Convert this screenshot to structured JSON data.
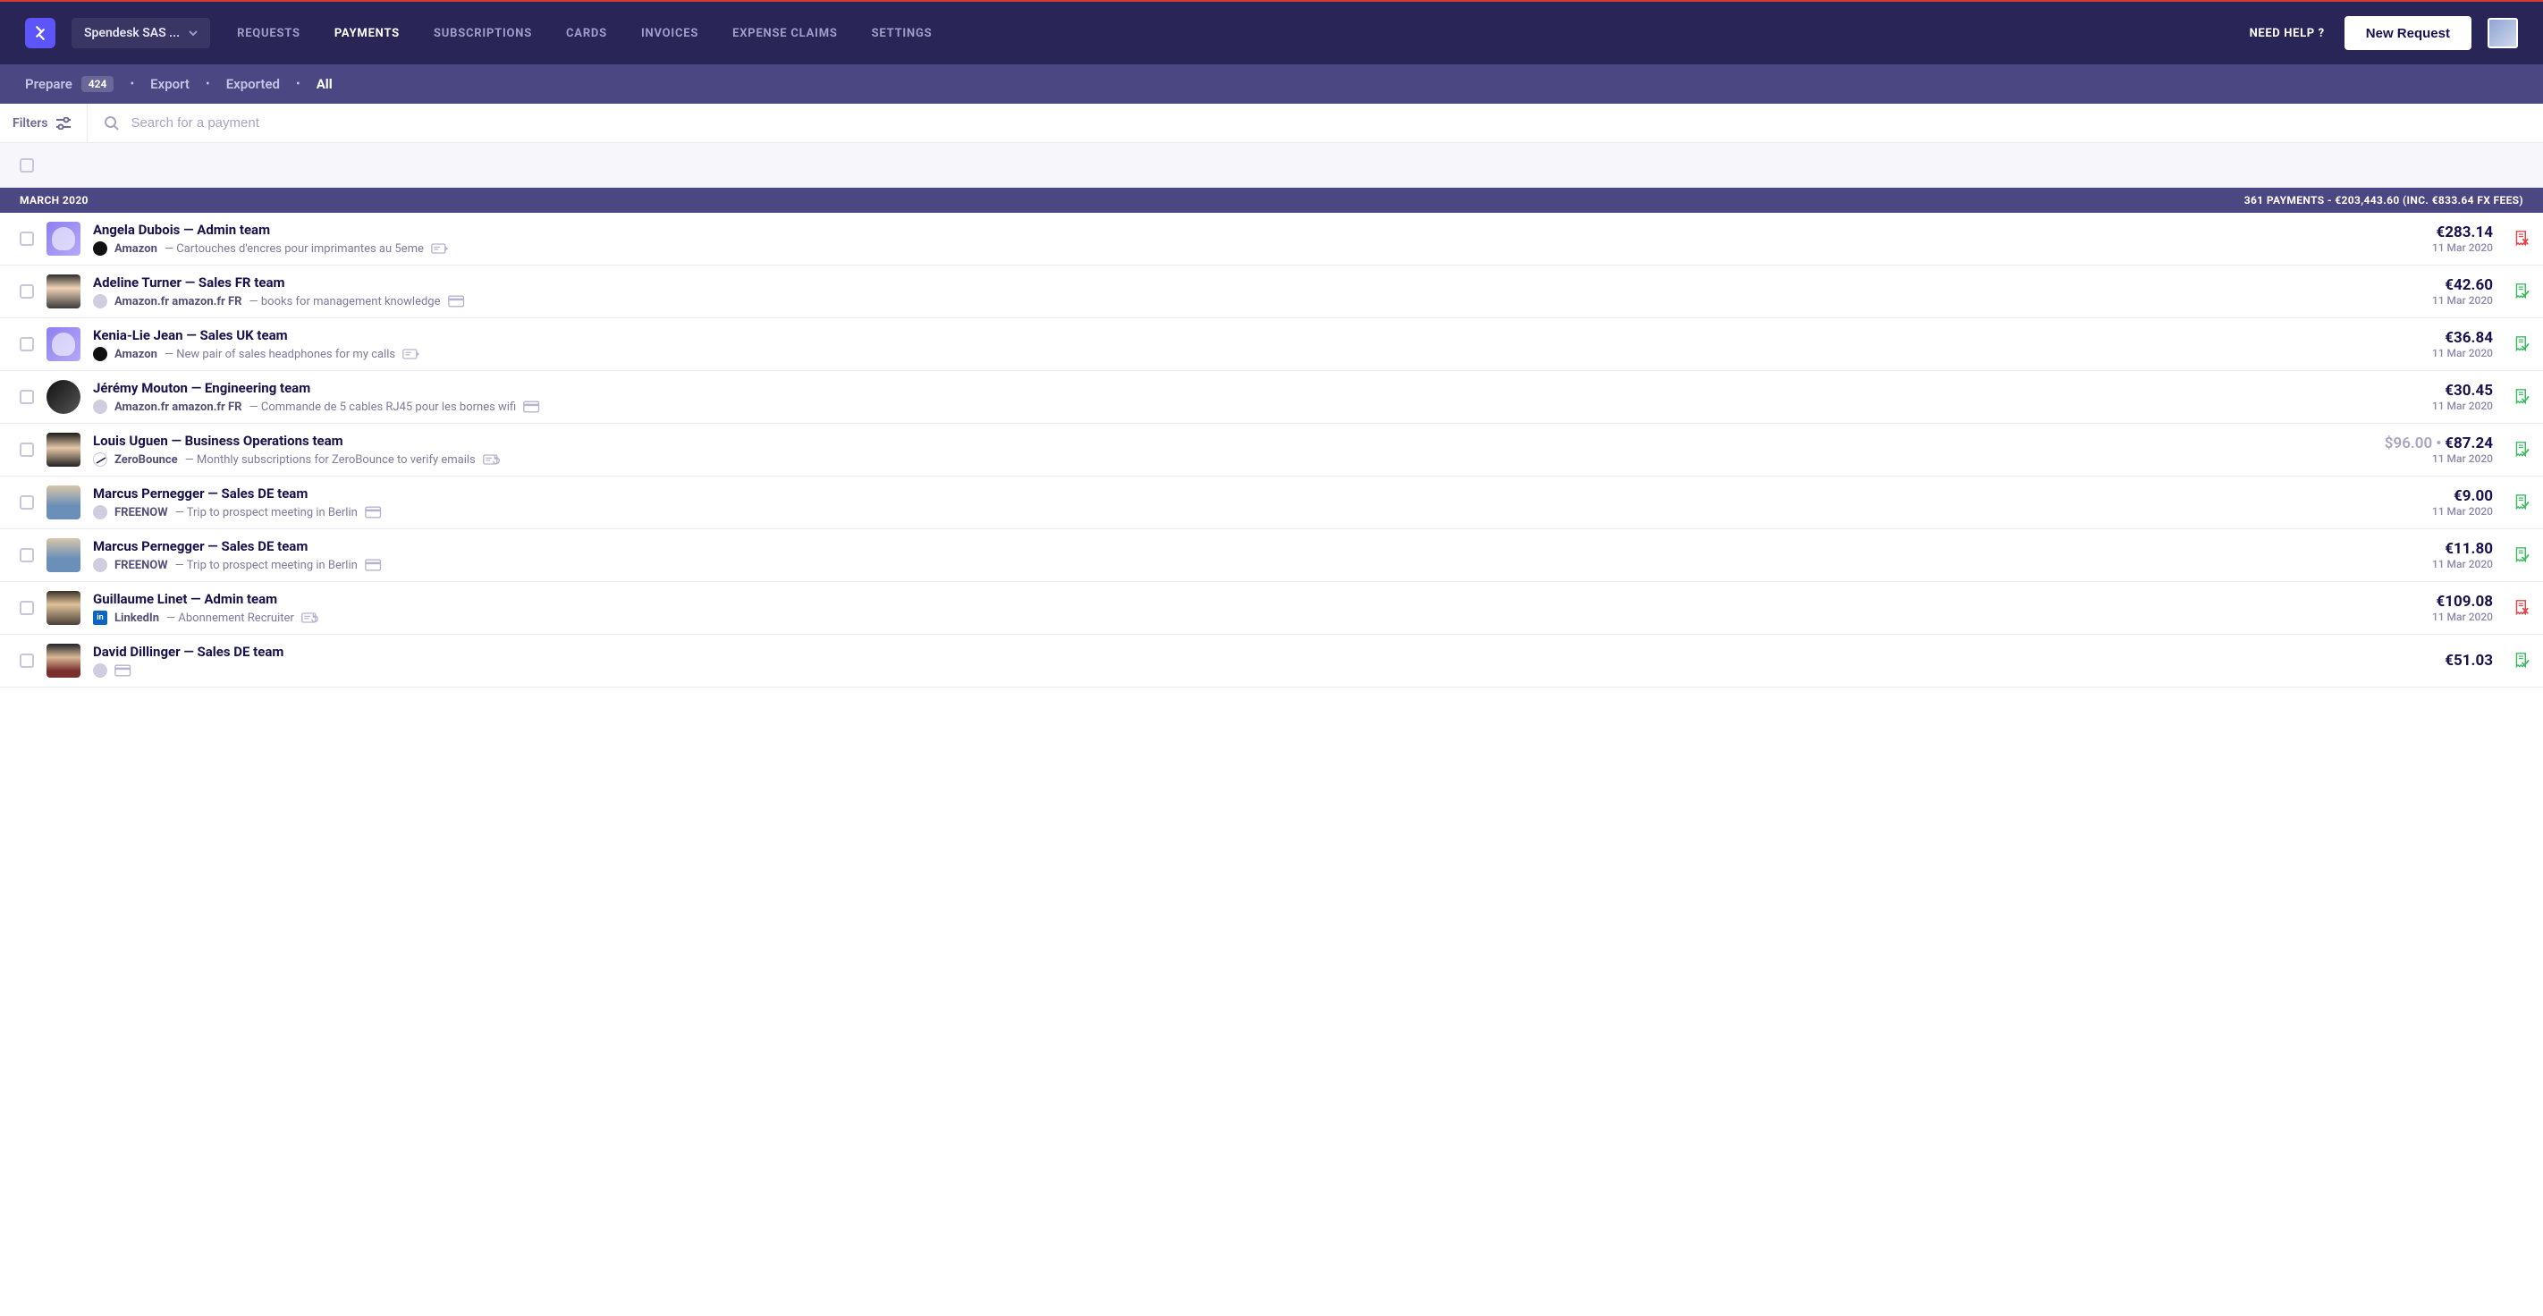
{
  "topbar": {
    "account_name": "Spendesk SAS ...",
    "nav": {
      "requests": "REQUESTS",
      "payments": "PAYMENTS",
      "subscriptions": "SUBSCRIPTIONS",
      "cards": "CARDS",
      "invoices": "INVOICES",
      "expense_claims": "EXPENSE CLAIMS",
      "settings": "SETTINGS"
    },
    "need_help": "NEED HELP ?",
    "new_request": "New Request"
  },
  "subnav": {
    "prepare": "Prepare",
    "prepare_count": "424",
    "export": "Export",
    "exported": "Exported",
    "all": "All"
  },
  "filter_bar": {
    "filters": "Filters",
    "search_placeholder": "Search for a payment"
  },
  "month_bar": {
    "label": "MARCH 2020",
    "summary": "361 PAYMENTS - €203,443.60 (INC. €833.64 FX FEES)"
  },
  "rows": [
    {
      "title": "Angela Dubois — Admin team",
      "merchant": "Amazon",
      "desc": "— Cartouches d'encres pour imprimantes au 5eme",
      "amount": "€283.14",
      "date": "11 Mar 2020",
      "status": "missing",
      "avatar_class": "purple",
      "merchant_color": "#111",
      "tag_kind": "expense"
    },
    {
      "title": "Adeline Turner — Sales FR team",
      "merchant": "Amazon.fr amazon.fr FR",
      "desc": "— books for management knowledge",
      "amount": "€42.60",
      "date": "11 Mar 2020",
      "status": "ok",
      "avatar_class": "photo1",
      "merchant_color": "#d0cde0",
      "tag_kind": "card"
    },
    {
      "title": "Kenia-Lie Jean — Sales UK team",
      "merchant": "Amazon",
      "desc": "— New pair of sales headphones for my calls",
      "amount": "€36.84",
      "date": "11 Mar 2020",
      "status": "ok",
      "avatar_class": "purple",
      "merchant_color": "#111",
      "tag_kind": "expense"
    },
    {
      "title": "Jérémy Mouton — Engineering team",
      "merchant": "Amazon.fr amazon.fr FR",
      "desc": "— Commande de 5 cables RJ45 pour les bornes wifi",
      "amount": "€30.45",
      "date": "11 Mar 2020",
      "status": "ok",
      "avatar_class": "photo2",
      "merchant_color": "#d0cde0",
      "tag_kind": "card"
    },
    {
      "title": "Louis Uguen — Business Operations team",
      "merchant": "ZeroBounce",
      "desc": "— Monthly subscriptions for ZeroBounce to verify emails",
      "amount_orig": "$96.00",
      "amount": "€87.24",
      "date": "11 Mar 2020",
      "status": "ok",
      "avatar_class": "photo3",
      "merchant_color": "#fff",
      "merchant_border": true,
      "tag_kind": "recurring"
    },
    {
      "title": "Marcus Pernegger — Sales DE team",
      "merchant": "FREENOW",
      "desc": "— Trip to prospect meeting in Berlin",
      "amount": "€9.00",
      "date": "11 Mar 2020",
      "status": "ok",
      "avatar_class": "photo4",
      "merchant_color": "#d0cde0",
      "tag_kind": "card"
    },
    {
      "title": "Marcus Pernegger — Sales DE team",
      "merchant": "FREENOW",
      "desc": "— Trip to prospect meeting in Berlin",
      "amount": "€11.80",
      "date": "11 Mar 2020",
      "status": "ok",
      "avatar_class": "photo4",
      "merchant_color": "#d0cde0",
      "tag_kind": "card"
    },
    {
      "title": "Guillaume Linet — Admin team",
      "merchant": "LinkedIn",
      "desc": "— Abonnement Recruiter",
      "amount": "€109.08",
      "date": "11 Mar 2020",
      "status": "missing",
      "avatar_class": "photo5",
      "merchant_color": "#0a66c2",
      "merchant_square": true,
      "tag_kind": "recurring"
    },
    {
      "title": "David Dillinger — Sales DE team",
      "merchant": "",
      "desc": "",
      "amount": "€51.03",
      "date": "",
      "status": "ok",
      "avatar_class": "photo6",
      "merchant_color": "#d0cde0",
      "tag_kind": "card"
    }
  ]
}
